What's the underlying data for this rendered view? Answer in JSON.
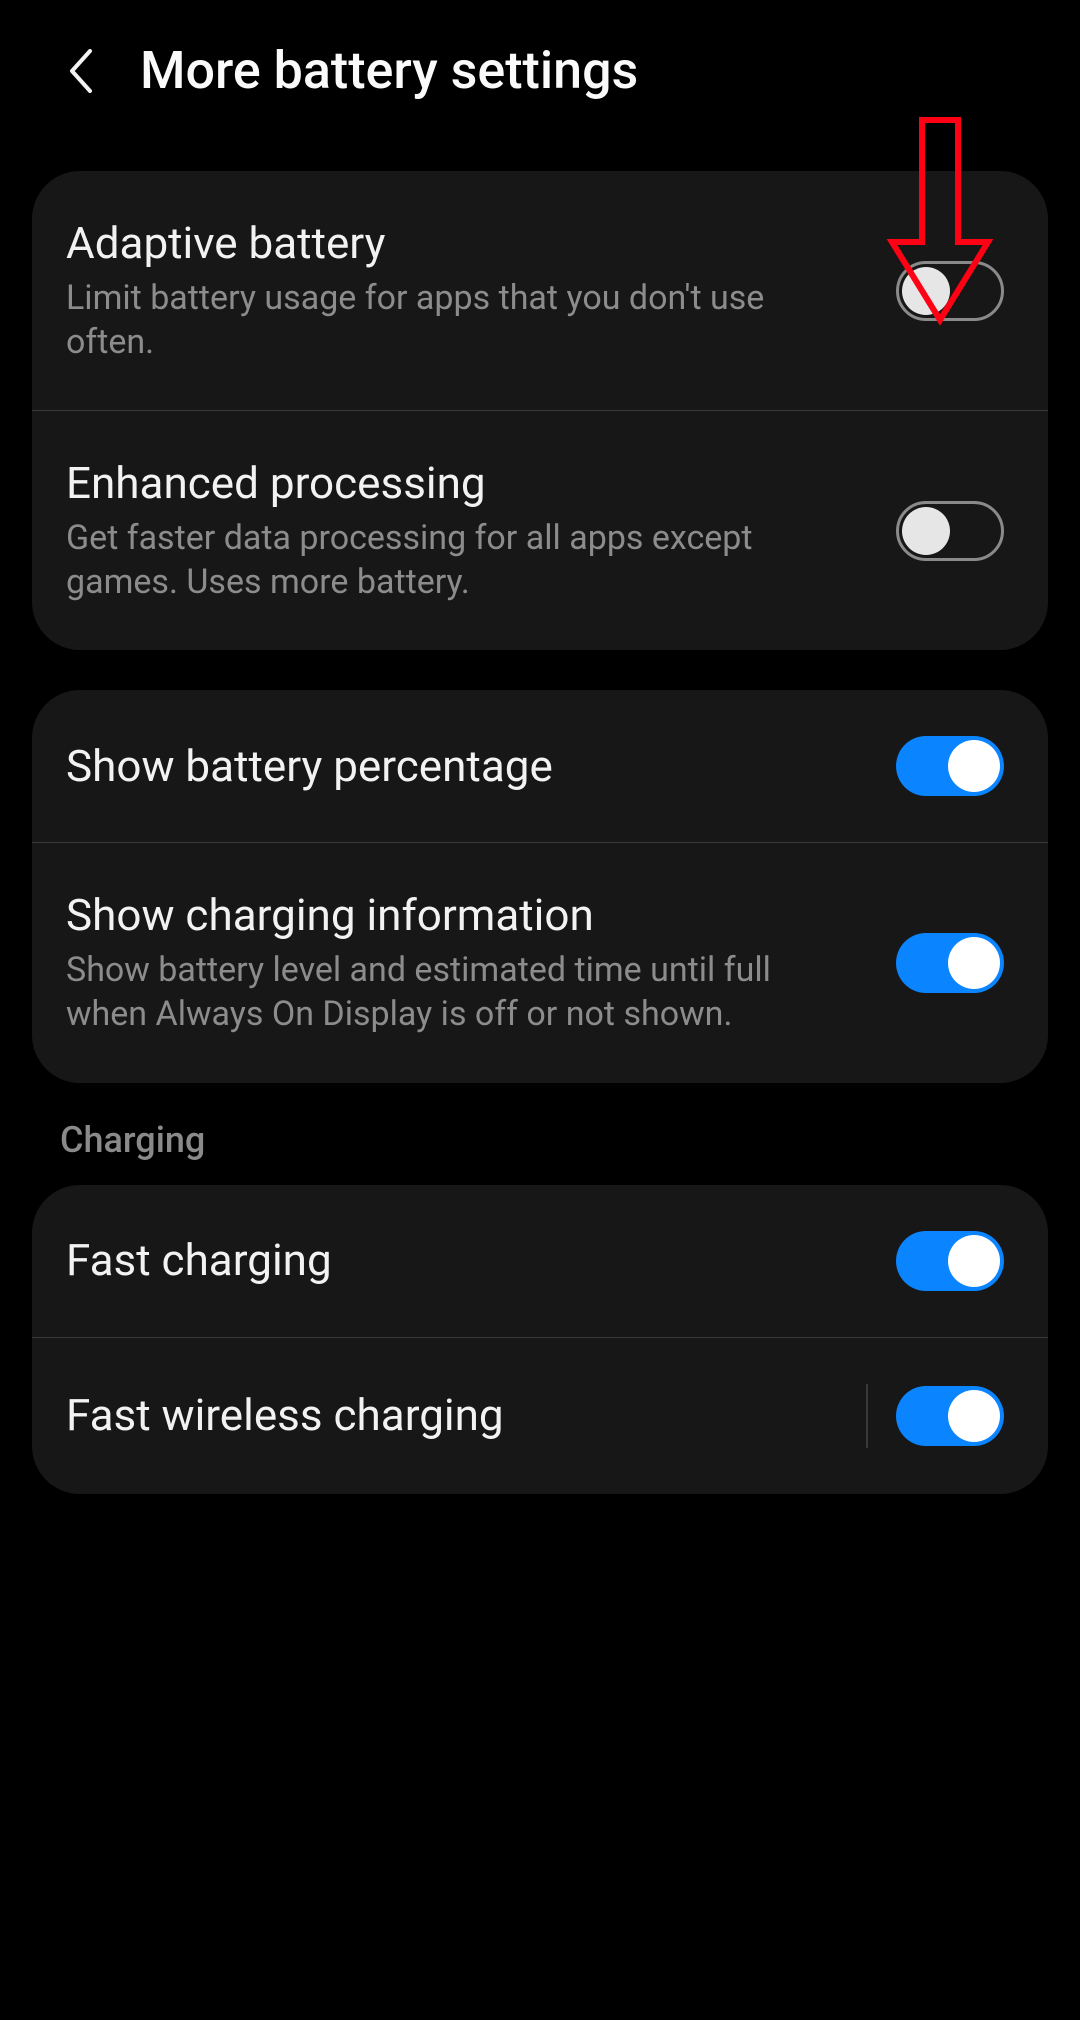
{
  "header": {
    "title": "More battery settings"
  },
  "sections": {
    "group1": {
      "adaptive": {
        "title": "Adaptive battery",
        "desc": "Limit battery usage for apps that you don't use often.",
        "on": false
      },
      "enhanced": {
        "title": "Enhanced processing",
        "desc": "Get faster data processing for all apps except games. Uses more battery.",
        "on": false
      }
    },
    "group2": {
      "percentage": {
        "title": "Show battery percentage",
        "on": true
      },
      "charging_info": {
        "title": "Show charging information",
        "desc": "Show battery level and estimated time until full when Always On Display is off or not shown.",
        "on": true
      }
    },
    "charging": {
      "label": "Charging",
      "fast": {
        "title": "Fast charging",
        "on": true
      },
      "fast_wireless": {
        "title": "Fast wireless charging",
        "on": true
      }
    }
  },
  "annotation": {
    "arrow_color": "#ff0014"
  }
}
